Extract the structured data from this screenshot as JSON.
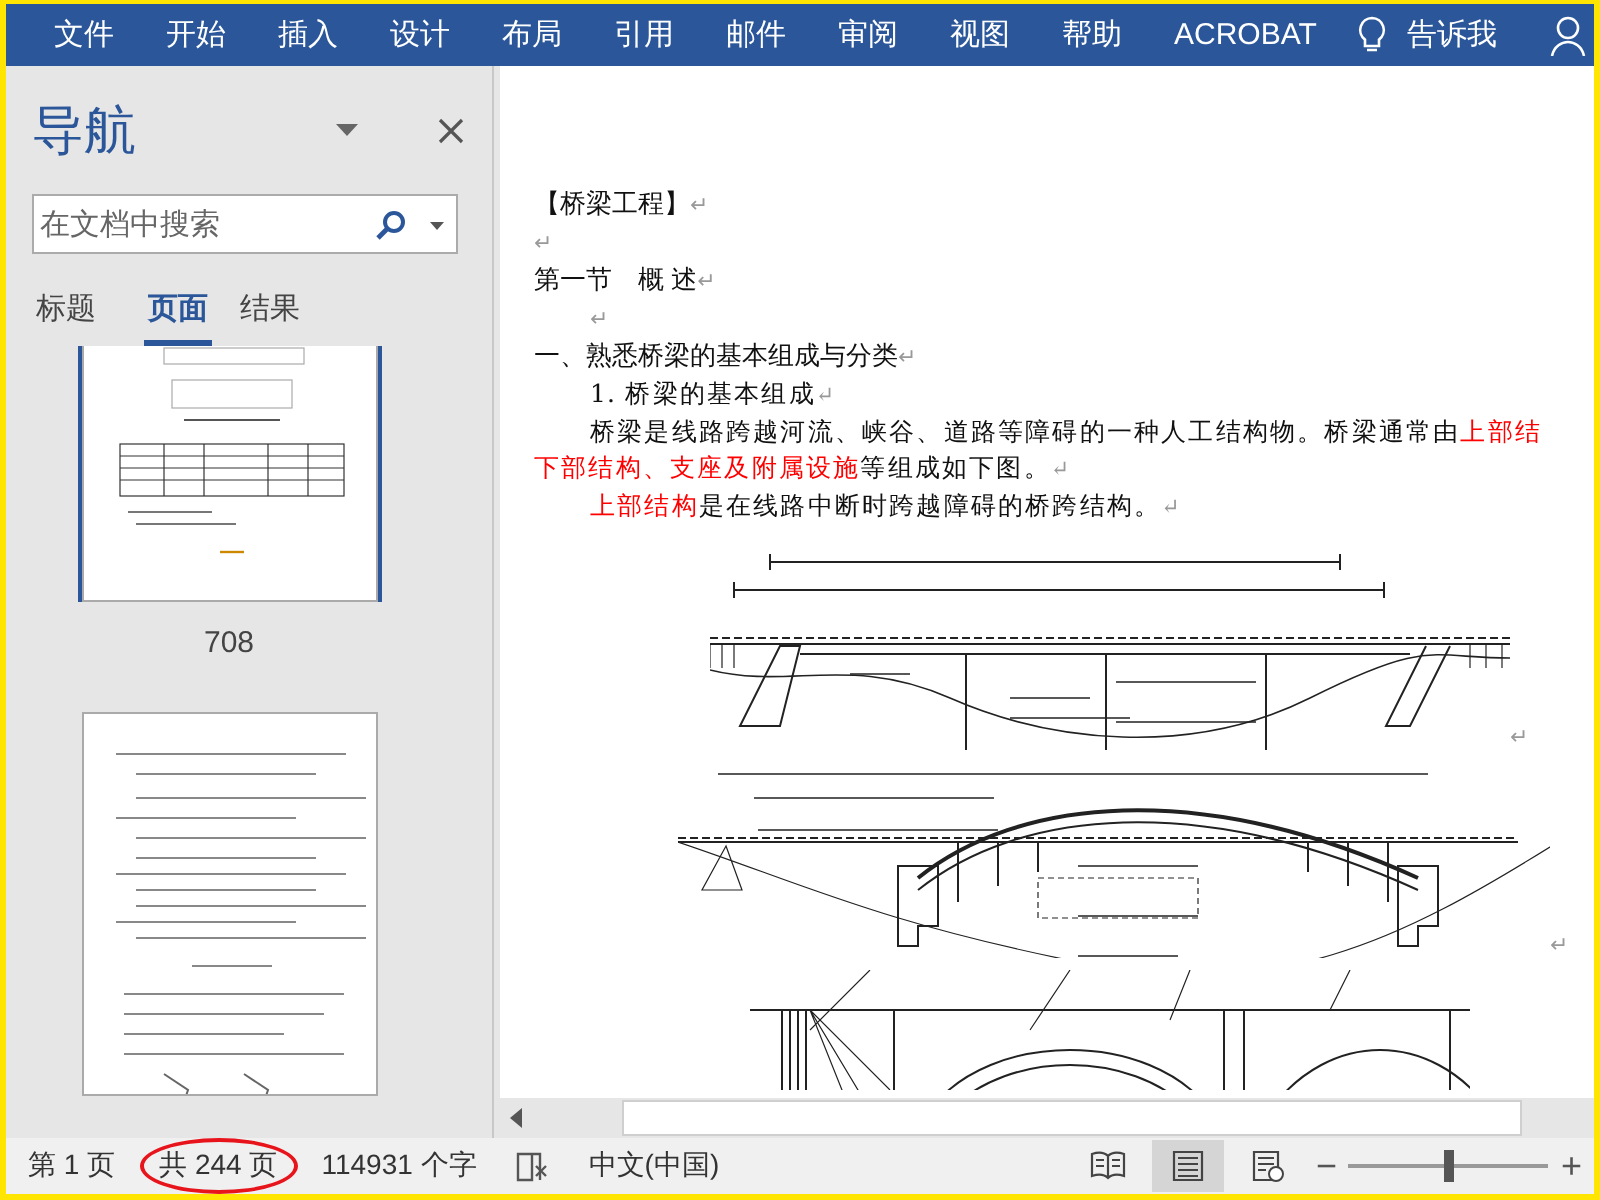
{
  "ribbon": {
    "tabs": [
      {
        "label": "文件",
        "selected": false
      },
      {
        "label": "开始",
        "selected": false
      },
      {
        "label": "插入",
        "selected": false
      },
      {
        "label": "设计",
        "selected": false
      },
      {
        "label": "布局",
        "selected": false
      },
      {
        "label": "引用",
        "selected": false
      },
      {
        "label": "邮件",
        "selected": false
      },
      {
        "label": "审阅",
        "selected": false
      },
      {
        "label": "视图",
        "selected": false
      },
      {
        "label": "帮助",
        "selected": false
      },
      {
        "label": "ACROBAT",
        "selected": false
      }
    ],
    "tell_me": "告诉我"
  },
  "navigation": {
    "title": "导航",
    "search": {
      "placeholder": "在文档中搜索"
    },
    "tabs": [
      {
        "label": "标题",
        "selected": false
      },
      {
        "label": "页面",
        "selected": true
      },
      {
        "label": "结果",
        "selected": false
      }
    ],
    "thumbnails": [
      {
        "selected": true,
        "label": "708"
      },
      {
        "selected": false
      }
    ]
  },
  "document": {
    "blocks": [
      {
        "kind": "heading",
        "runs": [
          {
            "text": "【桥梁工程】",
            "highlight": false
          }
        ],
        "mark": "↵"
      },
      {
        "kind": "heading",
        "mark": "↵"
      },
      {
        "kind": "heading",
        "runs": [
          {
            "text": "第一节　概 述",
            "highlight": false
          }
        ],
        "mark": "↵"
      },
      {
        "kind": "indented-heading",
        "mark": "↵"
      },
      {
        "kind": "heading",
        "runs": [
          {
            "text": "一、熟悉桥梁的基本组成与分类",
            "highlight": false
          }
        ],
        "mark": "↵"
      },
      {
        "kind": "indented-body",
        "runs": [
          {
            "text": "1. 桥梁的基本组成",
            "highlight": false
          }
        ],
        "mark": "↵"
      },
      {
        "kind": "indented-body",
        "runs": [
          {
            "text": "桥梁是线路跨越河流、峡谷、道路等障碍的一种人工结构物。桥梁通常由",
            "highlight": false
          },
          {
            "text": "上部结",
            "highlight": true
          }
        ]
      },
      {
        "kind": "body",
        "runs": [
          {
            "text": "下部结构、支座及附属设施",
            "highlight": true
          },
          {
            "text": "等组成如下图。",
            "highlight": false
          }
        ],
        "mark": "↵"
      },
      {
        "kind": "indented-body",
        "runs": [
          {
            "text": "上部结构",
            "highlight": true
          },
          {
            "text": "是在线路中断时跨越障碍的桥跨结构。",
            "highlight": false
          }
        ],
        "mark": "↵"
      },
      {
        "kind": "beam-figure",
        "mark": "↵"
      },
      {
        "kind": "arch-figure",
        "mark": "↵"
      },
      {
        "kind": "arch-detail-figure"
      }
    ]
  },
  "status_bar": {
    "items": [
      {
        "kind": "text",
        "text": "第 1 页",
        "circled": false
      },
      {
        "kind": "text",
        "text": "共 244 页",
        "circled": true
      },
      {
        "kind": "text",
        "text": "114931 个字",
        "circled": false
      },
      {
        "kind": "proofing-icon"
      },
      {
        "kind": "text",
        "text": "中文(中国)",
        "circled": false
      }
    ],
    "views": [
      {
        "kind": "read",
        "selected": false
      },
      {
        "kind": "print",
        "selected": true
      },
      {
        "kind": "web",
        "selected": false
      }
    ],
    "zoom": {
      "minus": "−",
      "plus": "+",
      "level": 0.5
    }
  }
}
